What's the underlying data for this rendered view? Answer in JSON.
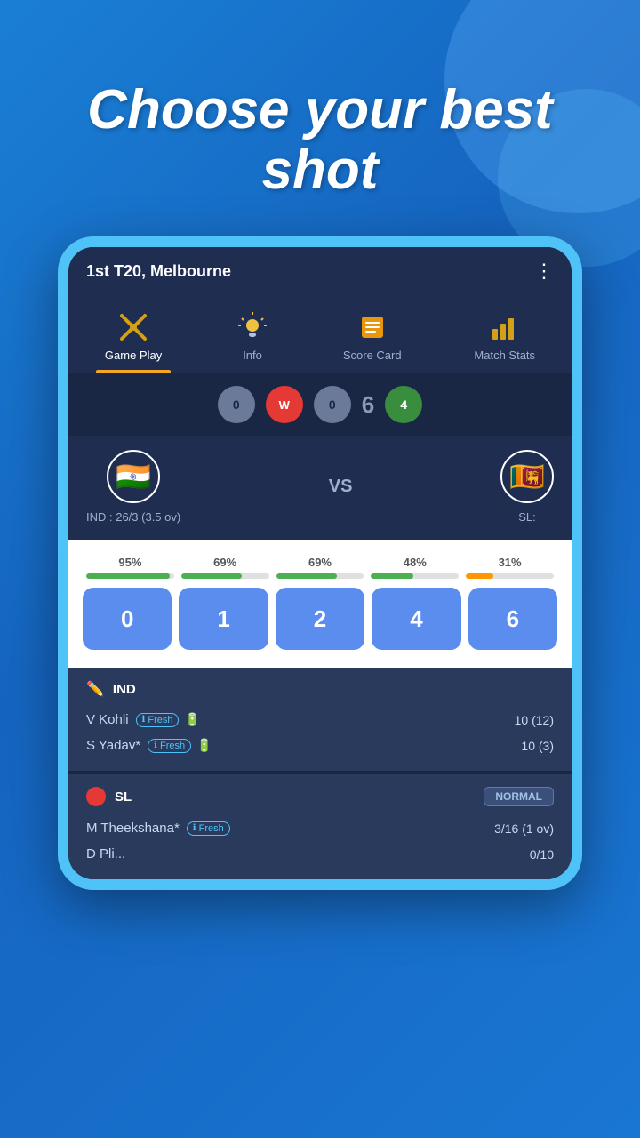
{
  "background": {
    "gradient_start": "#1a7fd4",
    "gradient_end": "#1565c0"
  },
  "headline": {
    "line1": "Choose your best",
    "line2": "shot"
  },
  "match_header": {
    "title": "1st T20, Melbourne",
    "more_icon": "⋮"
  },
  "tabs": [
    {
      "id": "gameplay",
      "label": "Game Play",
      "active": true
    },
    {
      "id": "info",
      "label": "Info",
      "active": false
    },
    {
      "id": "scorecard",
      "label": "Score Card",
      "active": false
    },
    {
      "id": "matchstats",
      "label": "Match Stats",
      "active": false
    }
  ],
  "deliveries": [
    {
      "type": "grey",
      "value": "0"
    },
    {
      "type": "wicket",
      "value": "W"
    },
    {
      "type": "grey",
      "value": "0"
    },
    {
      "type": "number",
      "value": "6"
    },
    {
      "type": "four",
      "value": "4"
    }
  ],
  "teams": {
    "team1": {
      "flag_emoji": "🇮🇳",
      "name": "IND",
      "score": "IND : 26/3 (3.5 ov)"
    },
    "vs": "VS",
    "team2": {
      "flag_emoji": "🇱🇰",
      "name": "SL",
      "score": "SL:"
    }
  },
  "shots": [
    {
      "value": "0",
      "percent": "95%",
      "bar_width": "95",
      "color": "green"
    },
    {
      "value": "1",
      "percent": "69%",
      "bar_width": "69",
      "color": "green"
    },
    {
      "value": "2",
      "percent": "69%",
      "bar_width": "69",
      "color": "green"
    },
    {
      "value": "4",
      "percent": "48%",
      "bar_width": "48",
      "color": "green"
    },
    {
      "value": "6",
      "percent": "31%",
      "bar_width": "31",
      "color": "orange"
    }
  ],
  "ind_panel": {
    "team": "IND",
    "players": [
      {
        "name": "V Kohli",
        "badge": "Fresh",
        "score": "10 (12)"
      },
      {
        "name": "S Yadav*",
        "badge": "Fresh",
        "score": "10 (3)"
      }
    ]
  },
  "sl_panel": {
    "team": "SL",
    "mode": "NORMAL",
    "players": [
      {
        "name": "M Theekshana*",
        "badge": "Fresh",
        "score": "3/16 (1 ov)"
      },
      {
        "name": "D Pli...",
        "badge": "",
        "score": "0/10"
      }
    ]
  }
}
